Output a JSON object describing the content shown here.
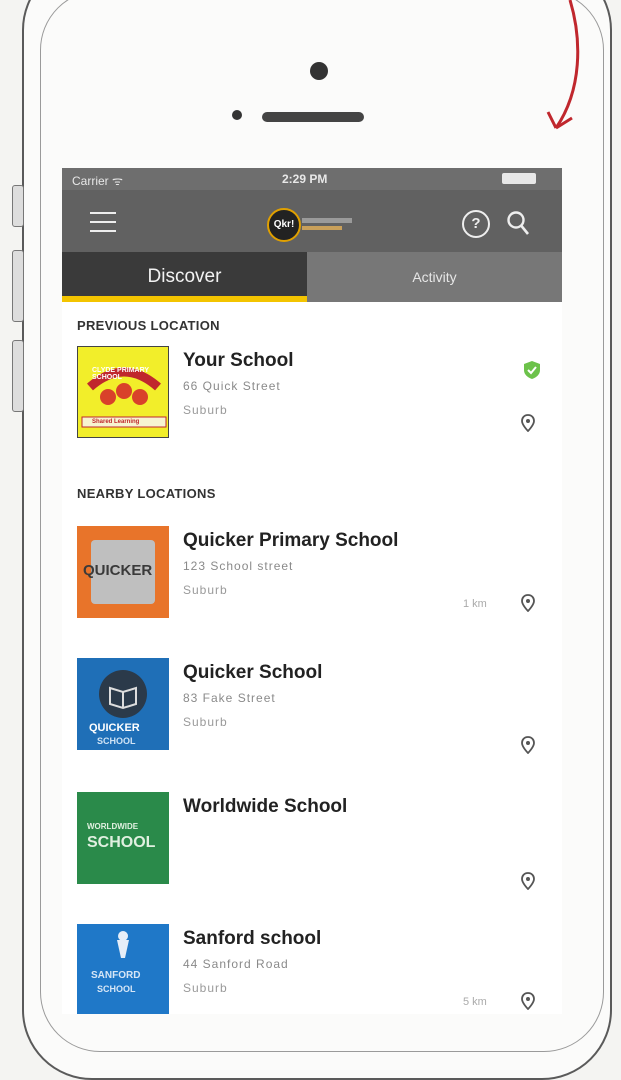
{
  "status_bar": {
    "carrier": "Carrier ᯤ",
    "time": "2:29 PM"
  },
  "nav": {
    "logo_text": "Qkr!",
    "icons": [
      "menu-icon",
      "help-icon",
      "search-icon"
    ]
  },
  "tabs": [
    {
      "label": "Discover",
      "active": true
    },
    {
      "label": "Activity",
      "active": false
    }
  ],
  "sections": {
    "previous": "PREVIOUS LOCATION",
    "nearby": "NEARBY LOCATIONS"
  },
  "previous_location": {
    "name": "Your School",
    "address": "66 Quick Street",
    "city": "Suburb",
    "thumb_text": "CLYDE PRIMARY SCHOOL",
    "thumb_motto": "Shared Learning"
  },
  "nearby_locations": [
    {
      "name": "Quicker Primary School",
      "address": "123 School street",
      "city": "Suburb",
      "distance": "1 km",
      "thumb_text": "QUICKER"
    },
    {
      "name": "Quicker School",
      "address": "83 Fake Street",
      "city": "Suburb",
      "distance": "",
      "thumb_text": "QUICKER",
      "thumb_sub": "SCHOOL"
    },
    {
      "name": "Worldwide School",
      "address": "",
      "city": "",
      "distance": "",
      "thumb_text": "WORLDWIDE",
      "thumb_sub": "SCHOOL"
    },
    {
      "name": "Sanford school",
      "address": "44 Sanford Road",
      "city": "Suburb",
      "distance": "5 km",
      "thumb_text": "SANFORD",
      "thumb_sub": "SCHOOL"
    }
  ],
  "colors": {
    "accent": "#f3c400",
    "nav": "#616161",
    "verified": "#6cc24a"
  }
}
